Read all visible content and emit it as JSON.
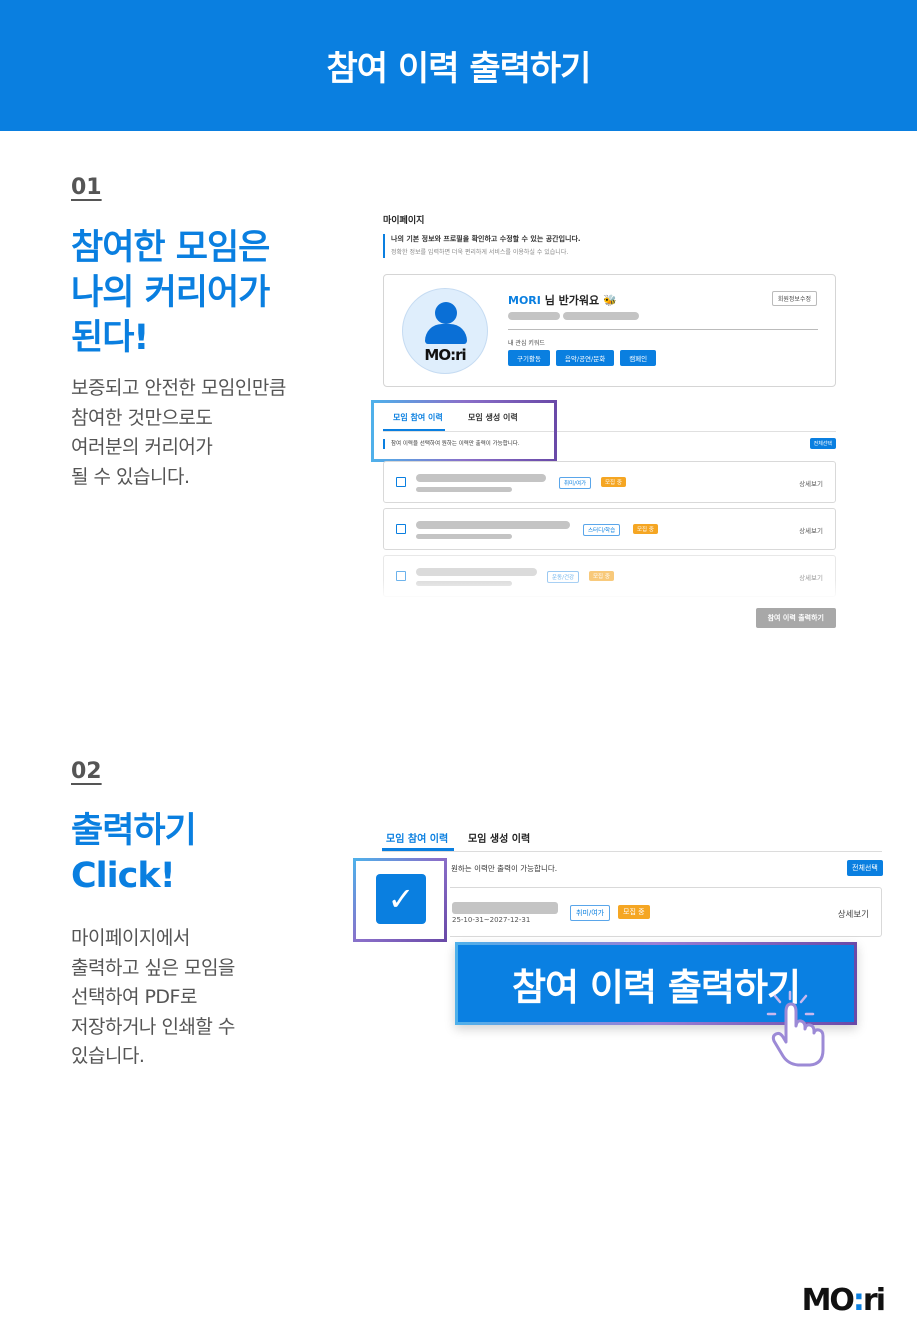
{
  "header": {
    "title": "참여 이력 출력하기"
  },
  "section1": {
    "number": "01",
    "headline": [
      "참여한 모임은",
      "나의 커리어가",
      "된다!"
    ],
    "description": [
      "보증되고 안전한 모임인만큼",
      "참여한 것만으로도",
      "여러분의 커리어가",
      "될 수 있습니다."
    ]
  },
  "mypage": {
    "title": "마이페이지",
    "info_line1": "나의 기본 정보와 프로필을 확인하고 수정할 수 있는 공간입니다.",
    "info_line2": "정확한 정보를 입력하면 더욱 편리하게 서비스를 이용하실 수 있습니다.",
    "avatar_logo": "MO:ri",
    "greeting_name": "MORI",
    "greeting_text": "님 반가워요",
    "greeting_emoji": "🐝",
    "edit_button": "회원정보수정",
    "keyword_label": "내 관심 키워드",
    "keywords": [
      "구기활동",
      "음악/공연/문화",
      "캠페인"
    ],
    "tabs": [
      "모임 참여 이력",
      "모임 생성 이력"
    ],
    "notice": "참여 이력을 선택하여 원하는 이력만 출력이 가능합니다.",
    "select_all": "전체선택",
    "rows": [
      {
        "category": "취미/여가",
        "status": "모집 중",
        "detail": "상세보기"
      },
      {
        "category": "스터디/학습",
        "status": "모집 중",
        "detail": "상세보기"
      },
      {
        "category": "운동/건강",
        "status": "모집 중",
        "detail": "상세보기"
      }
    ],
    "print_button": "참여 이력 출력하기"
  },
  "section2": {
    "number": "02",
    "headline": [
      "출력하기",
      "Click!"
    ],
    "description": [
      "마이페이지에서",
      "출력하고 싶은 모임을",
      "선택하여 PDF로",
      "저장하거나 인쇄할 수",
      "있습니다."
    ]
  },
  "zoom": {
    "tabs": [
      "모임 참여 이력",
      "모임 생성 이력"
    ],
    "notice": "원하는 이력만 출력이 가능합니다.",
    "select_all": "전체선택",
    "row_date": "25-10-31~2027-12-31",
    "category": "취미/여가",
    "status": "모집 중",
    "detail": "상세보기",
    "check_glyph": "✓",
    "print_button": "참여 이력 출력하기"
  },
  "footer": {
    "logo_main": "MO",
    "logo_dot": ":",
    "logo_end": "ri"
  },
  "colors": {
    "brand_blue": "#0a7fe0",
    "status_orange": "#f5a623",
    "gradient_purple": "#6a4aa8"
  }
}
